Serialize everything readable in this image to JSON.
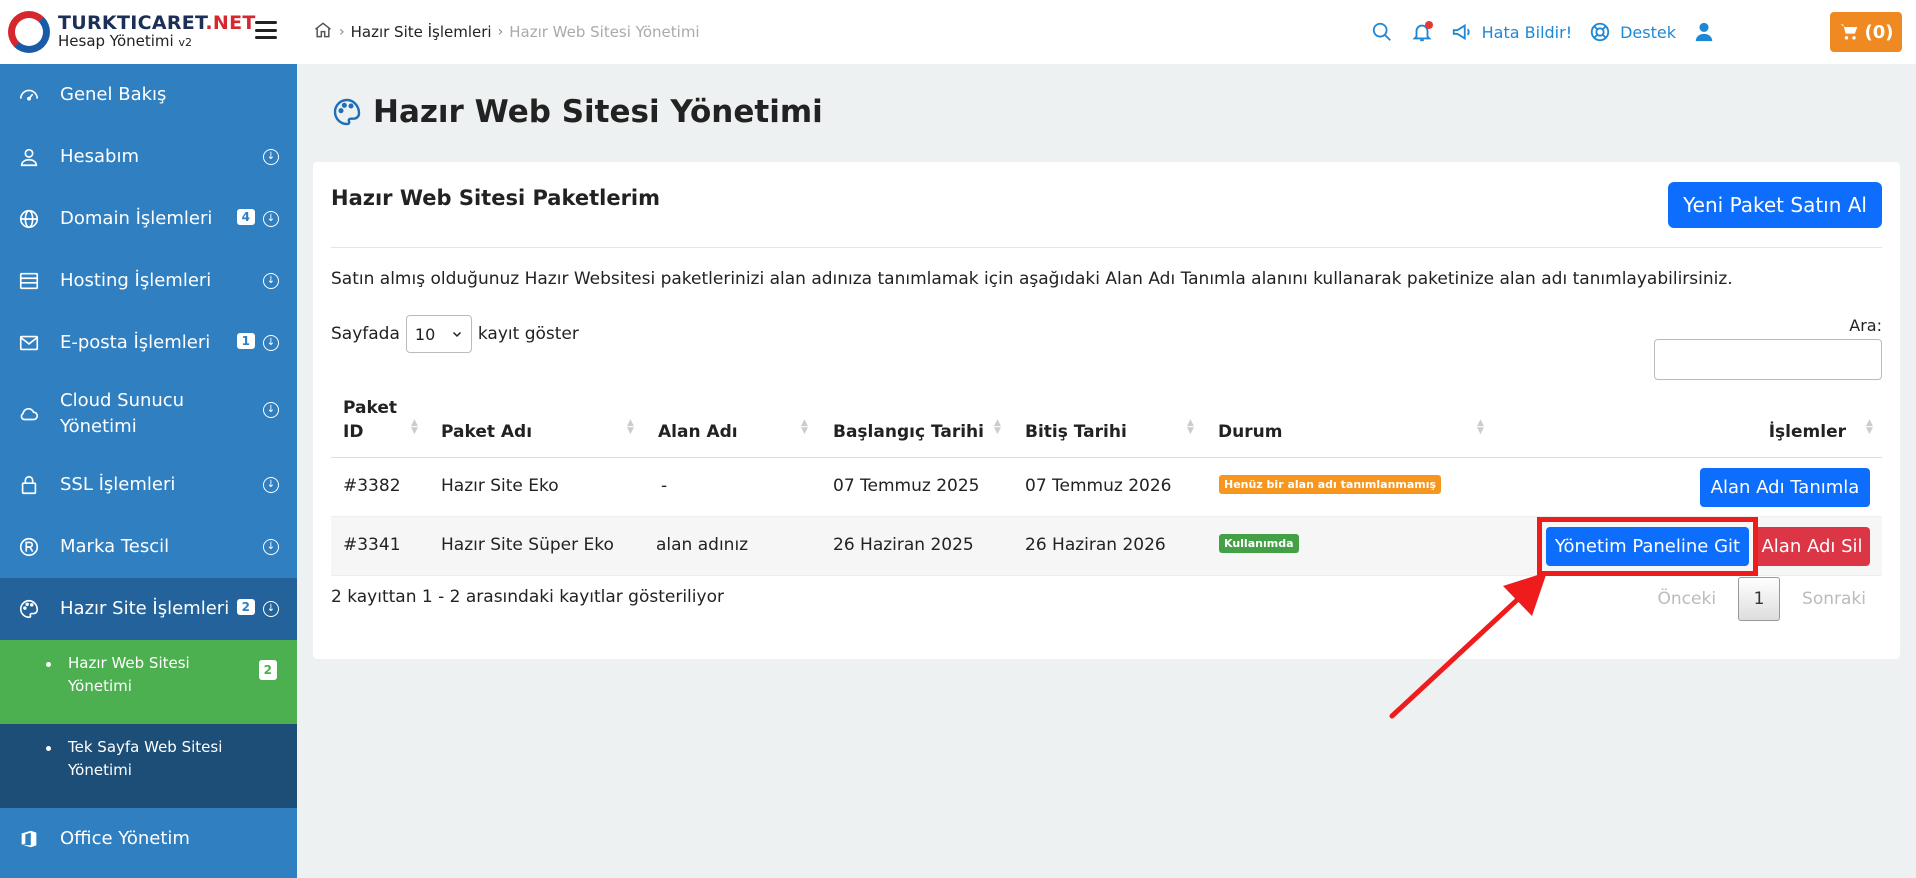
{
  "brand": {
    "name_main": "TURKTICARET",
    "name_net": ".NET",
    "subtitle": "Hesap Yönetimi",
    "version": "v2"
  },
  "sidebar": {
    "items": [
      {
        "label": "Genel Bakış",
        "icon": "dashboard-icon"
      },
      {
        "label": "Hesabım",
        "icon": "user-icon",
        "expandable": true
      },
      {
        "label": "Domain İşlemleri",
        "icon": "globe-icon",
        "badge": "4",
        "expandable": true
      },
      {
        "label": "Hosting İşlemleri",
        "icon": "server-icon",
        "expandable": true
      },
      {
        "label": "E-posta İşlemleri",
        "icon": "mail-icon",
        "badge": "1",
        "expandable": true
      },
      {
        "label": "Cloud Sunucu Yönetimi",
        "icon": "cloud-icon",
        "expandable": true
      },
      {
        "label": "SSL İşlemleri",
        "icon": "lock-icon",
        "expandable": true
      },
      {
        "label": "Marka Tescil",
        "icon": "registered-icon",
        "expandable": true
      },
      {
        "label": "Hazır Site İşlemleri",
        "icon": "palette-icon",
        "badge": "2",
        "expandable": true,
        "active": true
      },
      {
        "label": "Office Yönetim",
        "icon": "office-icon"
      }
    ],
    "subitems": [
      {
        "label": "Hazır Web Sitesi Yönetimi",
        "badge": "2",
        "active": true
      },
      {
        "label": "Tek Sayfa Web Sitesi Yönetimi"
      }
    ]
  },
  "breadcrumb": {
    "parent": "Hazır Site İşlemleri",
    "current": "Hazır Web Sitesi Yönetimi"
  },
  "topbar": {
    "report_label": "Hata Bildir!",
    "support_label": "Destek",
    "cart_count": "(0)"
  },
  "page": {
    "title": "Hazır Web Sitesi Yönetimi"
  },
  "card": {
    "title": "Hazır Web Sitesi Paketlerim",
    "new_button": "Yeni Paket Satın Al",
    "description": "Satın almış olduğunuz Hazır Websitesi paketlerinizi alan adınıza tanımlamak için aşağıdaki Alan Adı Tanımla alanını kullanarak paketinize alan adı tanımlayabilirsiniz.",
    "length_prefix": "Sayfada",
    "length_value": "10",
    "length_suffix": "kayıt göster",
    "search_label": "Ara:",
    "search_value": ""
  },
  "table": {
    "headers": {
      "id": "Paket ID",
      "name": "Paket Adı",
      "domain": "Alan Adı",
      "start": "Başlangıç Tarihi",
      "end": "Bitiş Tarihi",
      "status": "Durum",
      "actions": "İşlemler"
    },
    "rows": [
      {
        "id": "#3382",
        "name": "Hazır Site Eko",
        "domain": "-",
        "start": "07 Temmuz 2025",
        "end": "07 Temmuz 2026",
        "status": "Henüz bir alan adı tanımlanmamış",
        "status_color": "#f6961e",
        "action_primary": "Alan Adı Tanımla"
      },
      {
        "id": "#3341",
        "name": "Hazır Site Süper Eko",
        "domain": "alan adınız",
        "start": "26 Haziran 2025",
        "end": "26 Haziran 2026",
        "status": "Kullanımda",
        "status_color": "#43a047",
        "action_primary": "Yönetim Paneline Git",
        "action_secondary": "Alan Adı Sil"
      }
    ],
    "info": "2 kayıttan 1 - 2 arasındaki kayıtlar gösteriliyor",
    "pager": {
      "prev": "Önceki",
      "current": "1",
      "next": "Sonraki"
    }
  },
  "colors": {
    "sidebar": "#2f7fc1",
    "primary": "#0d6efd",
    "danger": "#dc3545",
    "highlight": "#ee1c1c",
    "cart": "#ef8a22"
  }
}
